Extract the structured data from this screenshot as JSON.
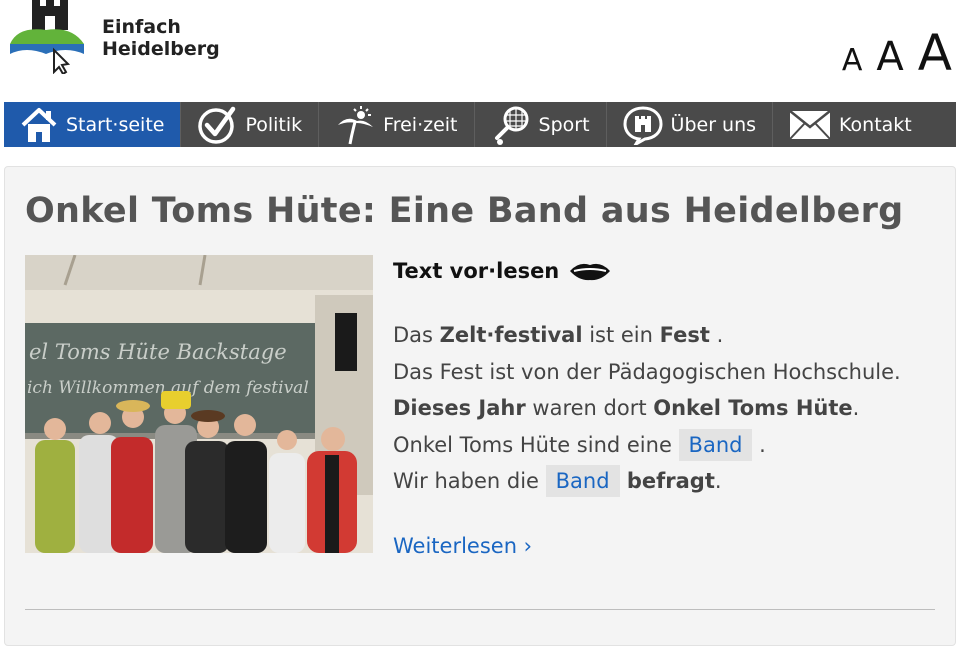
{
  "header": {
    "logo_line1": "Einfach",
    "logo_line2": "Heidelberg",
    "font_sizes": [
      "A",
      "A",
      "A"
    ]
  },
  "nav": {
    "items": [
      {
        "label": "Start·seite",
        "icon": "home-icon"
      },
      {
        "label": "Politik",
        "icon": "checkmark-icon"
      },
      {
        "label": "Frei·zeit",
        "icon": "palm-sun-icon"
      },
      {
        "label": "Sport",
        "icon": "racket-icon"
      },
      {
        "label": "Über uns",
        "icon": "castle-bubble-icon"
      },
      {
        "label": "Kontakt",
        "icon": "envelope-icon"
      }
    ],
    "active_index": 0,
    "colors": {
      "bar": "#4a4a4a",
      "active": "#1f5aab"
    }
  },
  "article": {
    "title": "Onkel Toms Hüte: Eine Band aus Heidelberg",
    "read_aloud": "Text vor·lesen",
    "read_aloud_icon": "lips-icon",
    "photo_text": {
      "board_line1": "el Toms Hüte Backstage",
      "board_line2": "ich Willkommen auf dem festival"
    },
    "lines": {
      "l1_a": "Das ",
      "l1_b": "Zelt·festival",
      "l1_c": " ist ein ",
      "l1_d": "Fest",
      "l1_e": " .",
      "l2": "Das Fest ist von der Pädagogischen Hochschule.",
      "l3_a": "Dieses Jahr",
      "l3_b": " waren dort ",
      "l3_c": "Onkel Toms Hüte",
      "l3_d": ".",
      "l4_a": "Onkel Toms Hüte sind eine ",
      "l4_tag": "Band",
      "l4_c": " .",
      "l5_a": "Wir haben die ",
      "l5_tag": "Band",
      "l5_c": " befragt",
      "l5_d": "."
    },
    "more": "Weiterlesen ›",
    "link_color": "#1a66c2"
  }
}
